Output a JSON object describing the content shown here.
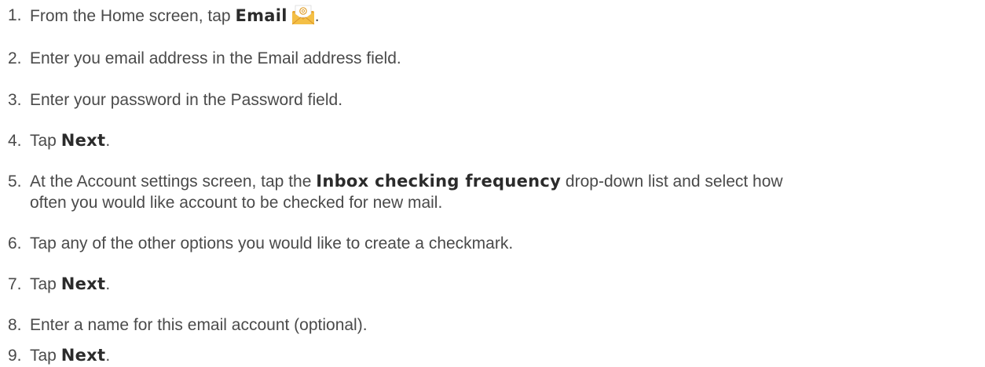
{
  "steps": [
    {
      "num": "1.",
      "before": "From the Home screen, tap ",
      "bold": "Email",
      "after": ".",
      "icon": "email-app-icon"
    },
    {
      "num": "2.",
      "text": "Enter you email address in the Email address field."
    },
    {
      "num": "3.",
      "text": "Enter your password in the Password field."
    },
    {
      "num": "4.",
      "before": "Tap ",
      "bold": "Next",
      "after": "."
    },
    {
      "num": "5.",
      "before": "At the Account settings screen, tap the ",
      "bold": "Inbox checking frequency",
      "after_line1": " drop-down list and select how",
      "after_line2": "often you would like account to be checked for new mail."
    },
    {
      "num": "6.",
      "text": "Tap any of the other options you would like to create a checkmark."
    },
    {
      "num": "7.",
      "before": "Tap ",
      "bold": "Next",
      "after": "."
    },
    {
      "num": "8.",
      "text": "Enter a name for this email account (optional)."
    },
    {
      "num": "9.",
      "before": "Tap ",
      "bold": "Next",
      "after": "."
    }
  ],
  "colors": {
    "text": "#4a4a4a",
    "bold_text": "#2b2b2b",
    "icon_envelope": "#f2b233",
    "icon_paper": "#ffffff"
  }
}
